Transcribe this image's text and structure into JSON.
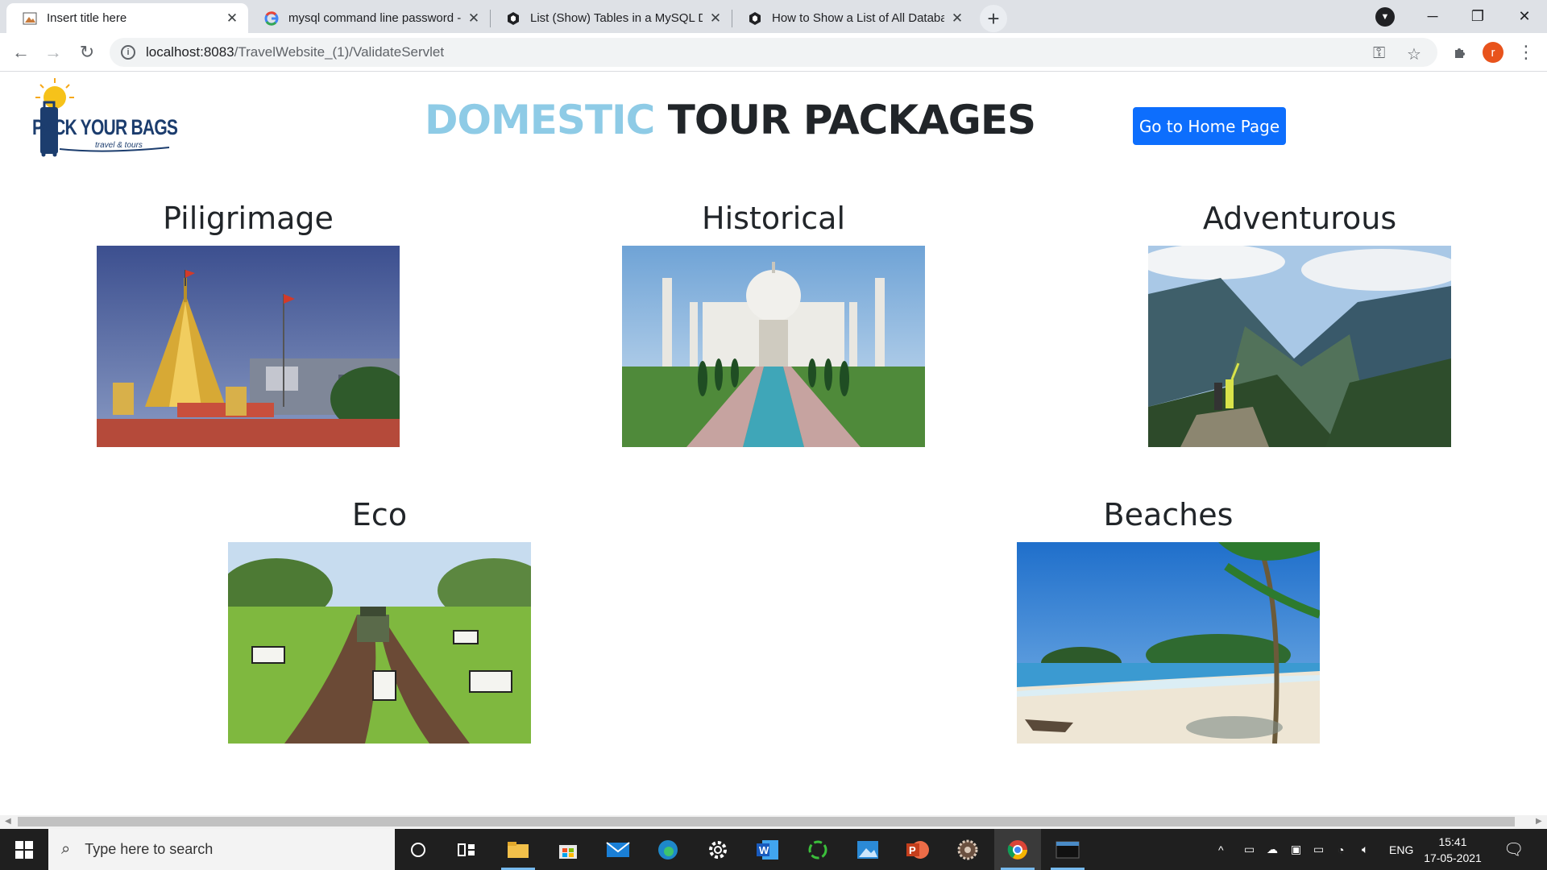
{
  "browser": {
    "tabs": [
      {
        "title": "Insert title here",
        "active": true
      },
      {
        "title": "mysql command line password -",
        "active": false
      },
      {
        "title": "List (Show) Tables in a MySQL Da",
        "active": false
      },
      {
        "title": "How to Show a List of All Databa",
        "active": false
      }
    ],
    "close_glyph": "✕",
    "new_tab_glyph": "+",
    "url_host": "localhost:8083",
    "url_path": "/TravelWebsite_(1)/ValidateServlet",
    "profile_initial": "r"
  },
  "page": {
    "logo": {
      "brand": "PACK YOUR BAGS",
      "tagline": "travel & tours"
    },
    "heading_part1": "DOMESTIC",
    "heading_part2": " TOUR PACKAGES",
    "home_button": "Go to Home Page",
    "packages": [
      {
        "name": "Piligrimage"
      },
      {
        "name": "Historical"
      },
      {
        "name": "Adventurous"
      },
      {
        "name": "Eco"
      },
      {
        "name": "Beaches"
      }
    ]
  },
  "taskbar": {
    "search_placeholder": "Type here to search",
    "language": "ENG",
    "time": "15:41",
    "date": "17-05-2021"
  },
  "colors": {
    "heading_accent": "#8ecbe6",
    "button": "#0d6efd",
    "taskbar": "#1f1f1f"
  }
}
